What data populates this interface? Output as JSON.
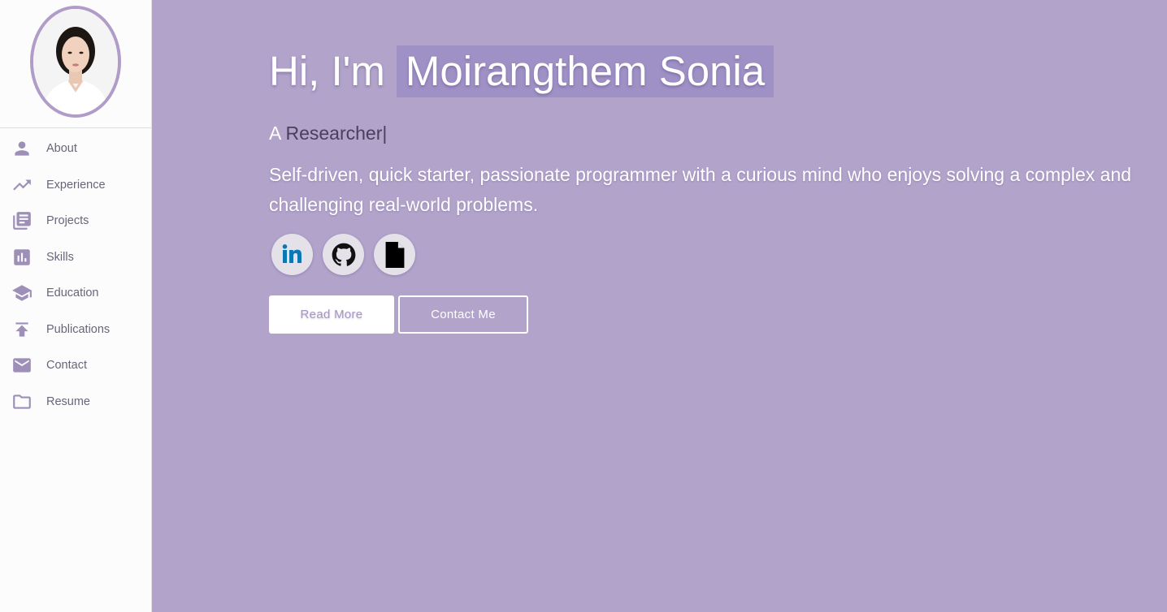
{
  "sidebar": {
    "profile_photo": "profile-photo",
    "items": [
      {
        "label": "About",
        "icon": "person-icon"
      },
      {
        "label": "Experience",
        "icon": "trending-up-icon"
      },
      {
        "label": "Projects",
        "icon": "library-books-icon"
      },
      {
        "label": "Skills",
        "icon": "bar-chart-icon"
      },
      {
        "label": "Education",
        "icon": "school-icon"
      },
      {
        "label": "Publications",
        "icon": "publish-icon"
      },
      {
        "label": "Contact",
        "icon": "mail-icon"
      },
      {
        "label": "Resume",
        "icon": "folder-icon"
      }
    ]
  },
  "hero": {
    "greeting": "Hi, I'm",
    "name": "Moirangthem Sonia",
    "role_prefix": "A",
    "role_title": "Researcher",
    "role_cursor": "|",
    "tagline": "Self-driven, quick starter, passionate programmer with a curious mind who enjoys solving a complex and challenging real-world problems."
  },
  "socials": [
    {
      "icon": "linkedin-icon"
    },
    {
      "icon": "github-icon"
    },
    {
      "icon": "document-icon"
    }
  ],
  "buttons": {
    "read_more": "Read More",
    "contact_me": "Contact Me"
  },
  "colors": {
    "background": "#b1a3ca",
    "accent": "#9d8fb8",
    "sidebar": "#fcfcfd"
  }
}
